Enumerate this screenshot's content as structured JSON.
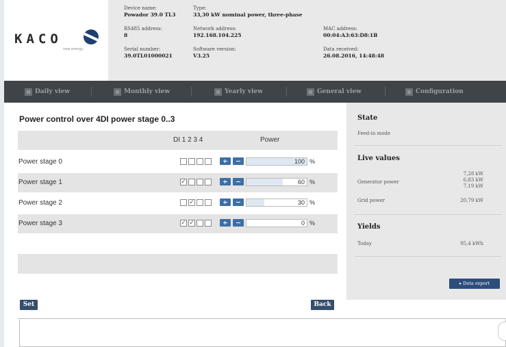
{
  "brand": {
    "name": "KACO",
    "tagline": "new energy."
  },
  "device_info": {
    "device_name": {
      "label": "Device name:",
      "value": "Powador 39.0 TL3"
    },
    "type": {
      "label": "Type:",
      "value": "33,30 kW nominal power, three-phase"
    },
    "rs485": {
      "label": "RS485 address:",
      "value": "8"
    },
    "network": {
      "label": "Network address:",
      "value": "192.168.104.225"
    },
    "mac": {
      "label": "MAC address:",
      "value": "00:04:A3:63:D8:1B"
    },
    "serial": {
      "label": "Serial number:",
      "value": "39.0TL01000021"
    },
    "software": {
      "label": "Software version:",
      "value": "V3.25"
    },
    "data_received": {
      "label": "Data received:",
      "value": "26.08.2016, 14:48:48"
    }
  },
  "nav": {
    "daily": "Daily view",
    "monthly": "Monthly view",
    "yearly": "Yearly view",
    "general": "General view",
    "configuration": "Configuration"
  },
  "main": {
    "title": "Power control over 4DI power stage 0..3",
    "col_di": "DI 1 2 3 4",
    "col_power": "Power",
    "unit": "%",
    "rows": [
      {
        "name": "Power stage 0",
        "checks": [
          false,
          false,
          false,
          false
        ],
        "power": 100
      },
      {
        "name": "Power stage 1",
        "checks": [
          true,
          false,
          false,
          false
        ],
        "power": 60
      },
      {
        "name": "Power stage 2",
        "checks": [
          false,
          true,
          false,
          false
        ],
        "power": 30
      },
      {
        "name": "Power stage 3",
        "checks": [
          true,
          true,
          false,
          false
        ],
        "power": 0
      }
    ],
    "set_label": "Set",
    "back_label": "Back"
  },
  "panel": {
    "state_title": "State",
    "state_value": "Feed-in mode",
    "live_title": "Live values",
    "generator_label": "Generator power",
    "generator_values": [
      "7,28 kW",
      "6,83 kW",
      "7,19 kW"
    ],
    "grid_label": "Grid power",
    "grid_value": "20,79 kW",
    "yields_title": "Yields",
    "today_label": "Today",
    "today_value": "95,4 kWh",
    "export_label": "▸ Data export"
  },
  "colors": {
    "nav_bg": "#3f4448",
    "button_blue": "#354e6c",
    "accent": "#3d6fa6"
  }
}
